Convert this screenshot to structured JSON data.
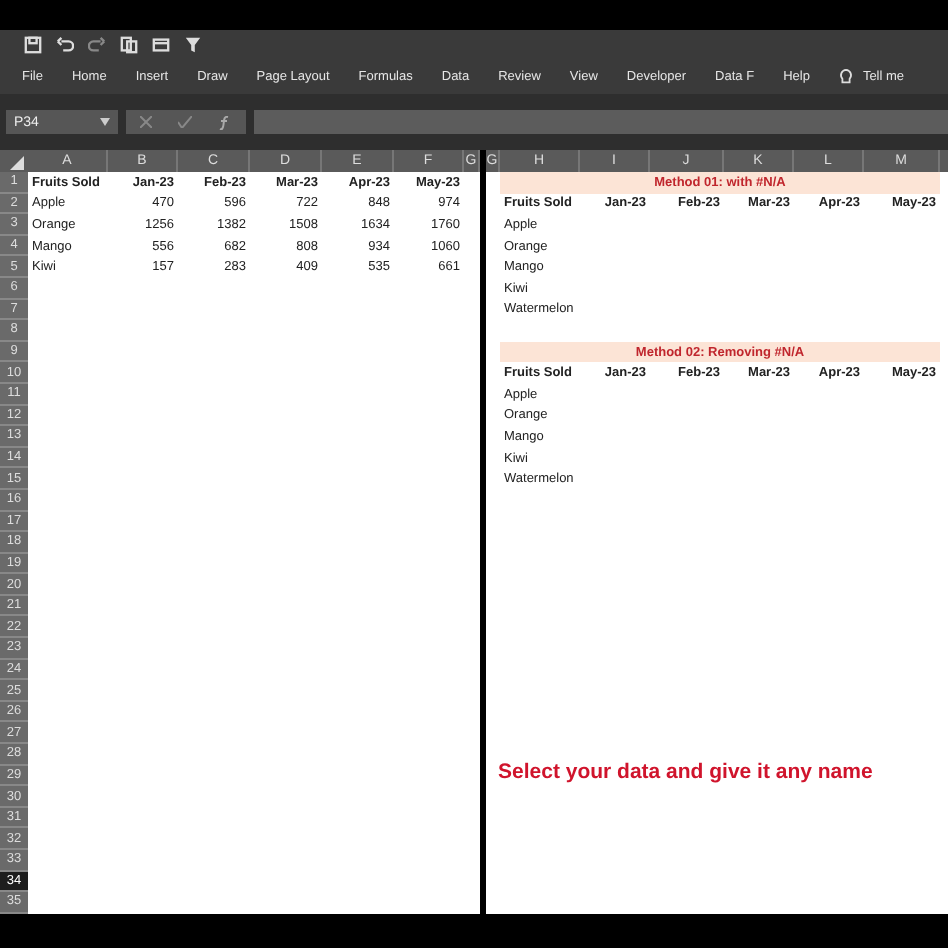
{
  "ribbon_tabs": [
    "File",
    "Home",
    "Insert",
    "Draw",
    "Page Layout",
    "Formulas",
    "Data",
    "Review",
    "View",
    "Developer",
    "Data F",
    "Help"
  ],
  "tell_me": "Tell me",
  "name_box": "P34",
  "left_pane": {
    "columns": [
      "A",
      "B",
      "C",
      "D",
      "E",
      "F",
      "G"
    ],
    "rows": [
      {
        "label": "1",
        "selected": false
      },
      {
        "label": "2",
        "selected": false
      },
      {
        "label": "3",
        "selected": false
      },
      {
        "label": "4",
        "selected": false
      },
      {
        "label": "5",
        "selected": false
      },
      {
        "label": "6",
        "selected": false
      },
      {
        "label": "7",
        "selected": false
      },
      {
        "label": "8",
        "selected": false
      },
      {
        "label": "9",
        "selected": false
      },
      {
        "label": "10",
        "selected": false
      },
      {
        "label": "11",
        "selected": false
      },
      {
        "label": "12",
        "selected": false
      },
      {
        "label": "13",
        "selected": false
      },
      {
        "label": "14",
        "selected": false
      },
      {
        "label": "15",
        "selected": false
      },
      {
        "label": "16",
        "selected": false
      },
      {
        "label": "17",
        "selected": false
      },
      {
        "label": "18",
        "selected": false
      },
      {
        "label": "19",
        "selected": false
      },
      {
        "label": "20",
        "selected": false
      },
      {
        "label": "21",
        "selected": false
      },
      {
        "label": "22",
        "selected": false
      },
      {
        "label": "23",
        "selected": false
      },
      {
        "label": "24",
        "selected": false
      },
      {
        "label": "25",
        "selected": false
      },
      {
        "label": "26",
        "selected": false
      },
      {
        "label": "27",
        "selected": false
      },
      {
        "label": "28",
        "selected": false
      },
      {
        "label": "29",
        "selected": false
      },
      {
        "label": "30",
        "selected": false
      },
      {
        "label": "31",
        "selected": false
      },
      {
        "label": "32",
        "selected": false
      },
      {
        "label": "33",
        "selected": false
      },
      {
        "label": "34",
        "selected": true
      },
      {
        "label": "35",
        "selected": false
      }
    ],
    "cells": [
      [
        "Fruits Sold",
        "Jan-23",
        "Feb-23",
        "Mar-23",
        "Apr-23",
        "May-23"
      ],
      [
        "Apple",
        "470",
        "596",
        "722",
        "848",
        "974"
      ],
      [
        "Orange",
        "1256",
        "1382",
        "1508",
        "1634",
        "1760"
      ],
      [
        "Mango",
        "556",
        "682",
        "808",
        "934",
        "1060"
      ],
      [
        "Kiwi",
        "157",
        "283",
        "409",
        "535",
        "661"
      ]
    ]
  },
  "right_pane": {
    "columns": [
      "G",
      "H",
      "I",
      "J",
      "K",
      "L",
      "M"
    ],
    "tables": [
      {
        "title": "Method 01: with #N/A",
        "header": [
          "Fruits Sold",
          "Jan-23",
          "Feb-23",
          "Mar-23",
          "Apr-23",
          "May-23"
        ],
        "items": [
          "Apple",
          "Orange",
          "Mango",
          "Kiwi",
          "Watermelon"
        ]
      },
      {
        "title": "Method 02: Removing #N/A",
        "header": [
          "Fruits Sold",
          "Jan-23",
          "Feb-23",
          "Mar-23",
          "Apr-23",
          "May-23"
        ],
        "items": [
          "Apple",
          "Orange",
          "Mango",
          "Kiwi",
          "Watermelon"
        ]
      }
    ]
  },
  "caption": "Select your data and give it any name"
}
